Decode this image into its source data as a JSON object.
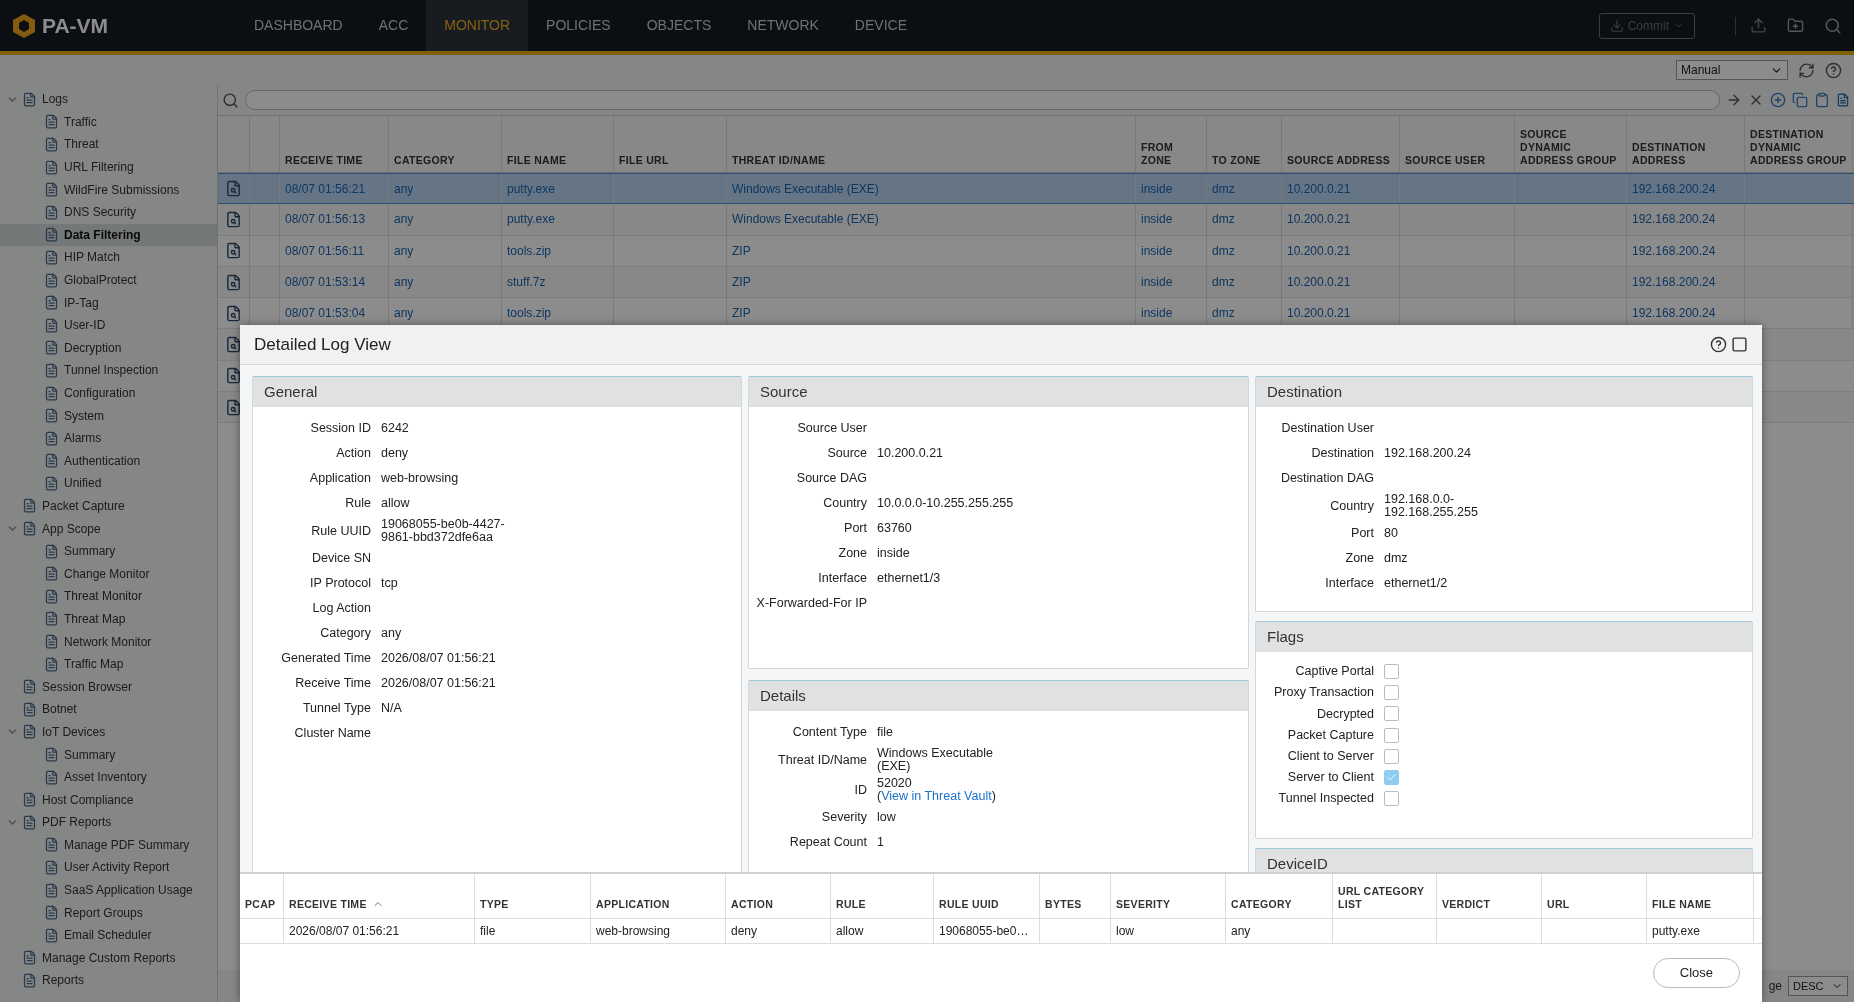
{
  "logo": "PA-VM",
  "nav": [
    {
      "label": "DASHBOARD",
      "selected": false
    },
    {
      "label": "ACC",
      "selected": false
    },
    {
      "label": "MONITOR",
      "selected": true
    },
    {
      "label": "POLICIES",
      "selected": false
    },
    {
      "label": "OBJECTS",
      "selected": false
    },
    {
      "label": "NETWORK",
      "selected": false
    },
    {
      "label": "DEVICE",
      "selected": false
    }
  ],
  "commit": {
    "label": "Commit",
    "disabled": true
  },
  "refresh_mode": "Manual",
  "sidebar": [
    {
      "label": "Logs",
      "selected": false,
      "expanded": true,
      "children": [
        {
          "label": "Traffic",
          "selected": false
        },
        {
          "label": "Threat",
          "selected": false
        },
        {
          "label": "URL Filtering",
          "selected": false
        },
        {
          "label": "WildFire Submissions",
          "selected": false
        },
        {
          "label": "DNS Security",
          "selected": false
        },
        {
          "label": "Data Filtering",
          "selected": true
        },
        {
          "label": "HIP Match",
          "selected": false
        },
        {
          "label": "GlobalProtect",
          "selected": false
        },
        {
          "label": "IP-Tag",
          "selected": false
        },
        {
          "label": "User-ID",
          "selected": false
        },
        {
          "label": "Decryption",
          "selected": false
        },
        {
          "label": "Tunnel Inspection",
          "selected": false
        },
        {
          "label": "Configuration",
          "selected": false
        },
        {
          "label": "System",
          "selected": false
        },
        {
          "label": "Alarms",
          "selected": false
        },
        {
          "label": "Authentication",
          "selected": false
        },
        {
          "label": "Unified",
          "selected": false
        }
      ]
    },
    {
      "label": "Packet Capture",
      "selected": false
    },
    {
      "label": "App Scope",
      "selected": false,
      "expanded": true,
      "children": [
        {
          "label": "Summary",
          "selected": false
        },
        {
          "label": "Change Monitor",
          "selected": false
        },
        {
          "label": "Threat Monitor",
          "selected": false
        },
        {
          "label": "Threat Map",
          "selected": false
        },
        {
          "label": "Network Monitor",
          "selected": false
        },
        {
          "label": "Traffic Map",
          "selected": false
        }
      ]
    },
    {
      "label": "Session Browser",
      "selected": false
    },
    {
      "label": "Botnet",
      "selected": false
    },
    {
      "label": "IoT Devices",
      "selected": false,
      "expanded": true,
      "children": [
        {
          "label": "Summary",
          "selected": false
        },
        {
          "label": "Asset Inventory",
          "selected": false
        }
      ]
    },
    {
      "label": "Host Compliance",
      "selected": false
    },
    {
      "label": "PDF Reports",
      "selected": false,
      "expanded": true,
      "children": [
        {
          "label": "Manage PDF Summary",
          "selected": false
        },
        {
          "label": "User Activity Report",
          "selected": false
        },
        {
          "label": "SaaS Application Usage",
          "selected": false
        },
        {
          "label": "Report Groups",
          "selected": false
        },
        {
          "label": "Email Scheduler",
          "selected": false
        }
      ]
    },
    {
      "label": "Manage Custom Reports",
      "selected": false
    },
    {
      "label": "Reports",
      "selected": false
    }
  ],
  "log_table": {
    "columns": [
      {
        "label": "RECEIVE TIME"
      },
      {
        "label": "CATEGORY"
      },
      {
        "label": "FILE NAME"
      },
      {
        "label": "FILE URL"
      },
      {
        "label": "THREAT ID/NAME"
      },
      {
        "label": "FROM ZONE"
      },
      {
        "label": "TO ZONE"
      },
      {
        "label": "SOURCE ADDRESS"
      },
      {
        "label": "SOURCE USER"
      },
      {
        "label": "SOURCE DYNAMIC ADDRESS GROUP"
      },
      {
        "label": "DESTINATION ADDRESS"
      },
      {
        "label": "DESTINATION DYNAMIC ADDRESS GROUP"
      }
    ],
    "rows": [
      {
        "kind": "full",
        "selected": true,
        "cells": [
          "08/07 01:56:21",
          "any",
          "putty.exe",
          null,
          "Windows Executable (EXE)",
          "inside",
          "dmz",
          "10.200.0.21",
          null,
          null,
          "192.168.200.24",
          null
        ]
      },
      {
        "kind": "full",
        "selected": false,
        "cells": [
          "08/07 01:56:13",
          "any",
          "putty.exe",
          null,
          "Windows Executable (EXE)",
          "inside",
          "dmz",
          "10.200.0.21",
          null,
          null,
          "192.168.200.24",
          null
        ]
      },
      {
        "kind": "full",
        "selected": false,
        "cells": [
          "08/07 01:56:11",
          "any",
          "tools.zip",
          null,
          "ZIP",
          "inside",
          "dmz",
          "10.200.0.21",
          null,
          null,
          "192.168.200.24",
          null
        ]
      },
      {
        "kind": "full",
        "selected": false,
        "cells": [
          "08/07 01:53:14",
          "any",
          "stuff.7z",
          null,
          "ZIP",
          "inside",
          "dmz",
          "10.200.0.21",
          null,
          null,
          "192.168.200.24",
          null
        ]
      },
      {
        "kind": "full",
        "selected": false,
        "cells": [
          "08/07 01:53:04",
          "any",
          "tools.zip",
          null,
          "ZIP",
          "inside",
          "dmz",
          "10.200.0.21",
          null,
          null,
          "192.168.200.24",
          null
        ]
      },
      {
        "kind": "covered",
        "selected": false
      },
      {
        "kind": "covered",
        "selected": false
      },
      {
        "kind": "covered",
        "selected": false
      }
    ]
  },
  "pager": {
    "label": "ge",
    "order": "DESC"
  },
  "dialog": {
    "title": "Detailed Log View",
    "general": {
      "title": "General",
      "fields": [
        {
          "label": "Session ID",
          "value": "6242"
        },
        {
          "label": "Action",
          "value": "deny"
        },
        {
          "label": "Application",
          "value": "web-browsing"
        },
        {
          "label": "Rule",
          "value": "allow"
        },
        {
          "label": "Rule UUID",
          "value": "19068055-be0b-4427-9861-bbd372dfe6aa"
        },
        {
          "label": "Device SN"
        },
        {
          "label": "IP Protocol",
          "value": "tcp"
        },
        {
          "label": "Log Action"
        },
        {
          "label": "Category",
          "value": "any"
        },
        {
          "label": "Generated Time",
          "value": "2026/08/07 01:56:21"
        },
        {
          "label": "Receive Time",
          "value": "2026/08/07 01:56:21"
        },
        {
          "label": "Tunnel Type",
          "value": "N/A"
        },
        {
          "label": "Cluster Name"
        }
      ]
    },
    "source": {
      "title": "Source",
      "fields": [
        {
          "label": "Source User"
        },
        {
          "label": "Source",
          "value": "10.200.0.21"
        },
        {
          "label": "Source DAG"
        },
        {
          "label": "Country",
          "value": "10.0.0.0-10.255.255.255"
        },
        {
          "label": "Port",
          "value": "63760"
        },
        {
          "label": "Zone",
          "value": "inside"
        },
        {
          "label": "Interface",
          "value": "ethernet1/3"
        },
        {
          "label": "X-Forwarded-For IP"
        }
      ]
    },
    "details": {
      "title": "Details",
      "fields": [
        {
          "label": "Content Type",
          "value": "file"
        },
        {
          "label": "Threat ID/Name",
          "value": "Windows Executable (EXE)"
        },
        {
          "label": "ID",
          "value": "52020 (",
          "link": "View in Threat Vault",
          "suffix": ")"
        },
        {
          "label": "Severity",
          "value": "low"
        },
        {
          "label": "Repeat Count",
          "value": "1"
        }
      ]
    },
    "destination": {
      "title": "Destination",
      "fields": [
        {
          "label": "Destination User"
        },
        {
          "label": "Destination",
          "value": "192.168.200.24"
        },
        {
          "label": "Destination DAG"
        },
        {
          "label": "Country",
          "value": "192.168.0.0-192.168.255.255"
        },
        {
          "label": "Port",
          "value": "80"
        },
        {
          "label": "Zone",
          "value": "dmz"
        },
        {
          "label": "Interface",
          "value": "ethernet1/2"
        }
      ]
    },
    "flags": {
      "title": "Flags",
      "items": [
        {
          "label": "Captive Portal",
          "checked": false
        },
        {
          "label": "Proxy Transaction",
          "checked": false
        },
        {
          "label": "Decrypted",
          "checked": false
        },
        {
          "label": "Packet Capture",
          "checked": false
        },
        {
          "label": "Client to Server",
          "checked": false
        },
        {
          "label": "Server to Client",
          "checked": true
        },
        {
          "label": "Tunnel Inspected",
          "checked": false
        }
      ]
    },
    "device_id": {
      "title": "DeviceID"
    },
    "related": {
      "columns": [
        {
          "label": "PCAP",
          "sorted": false
        },
        {
          "label": "RECEIVE TIME",
          "sorted": true
        },
        {
          "label": "TYPE",
          "sorted": false
        },
        {
          "label": "APPLICATION",
          "sorted": false
        },
        {
          "label": "ACTION",
          "sorted": false
        },
        {
          "label": "RULE",
          "sorted": false
        },
        {
          "label": "RULE UUID",
          "sorted": false
        },
        {
          "label": "BYTES",
          "sorted": false
        },
        {
          "label": "SEVERITY",
          "sorted": false
        },
        {
          "label": "CATEGORY",
          "sorted": false
        },
        {
          "label": "URL CATEGORY LIST",
          "sorted": false
        },
        {
          "label": "VERDICT",
          "sorted": false
        },
        {
          "label": "URL",
          "sorted": false
        },
        {
          "label": "FILE NAME",
          "sorted": false
        }
      ],
      "rows": [
        {
          "cells": [
            null,
            "2026/08/07 01:56:21",
            "file",
            "web-browsing",
            "deny",
            "allow",
            "19068055-be0…",
            null,
            "low",
            "any",
            null,
            null,
            null,
            "putty.exe"
          ]
        }
      ]
    },
    "close": "Close"
  }
}
